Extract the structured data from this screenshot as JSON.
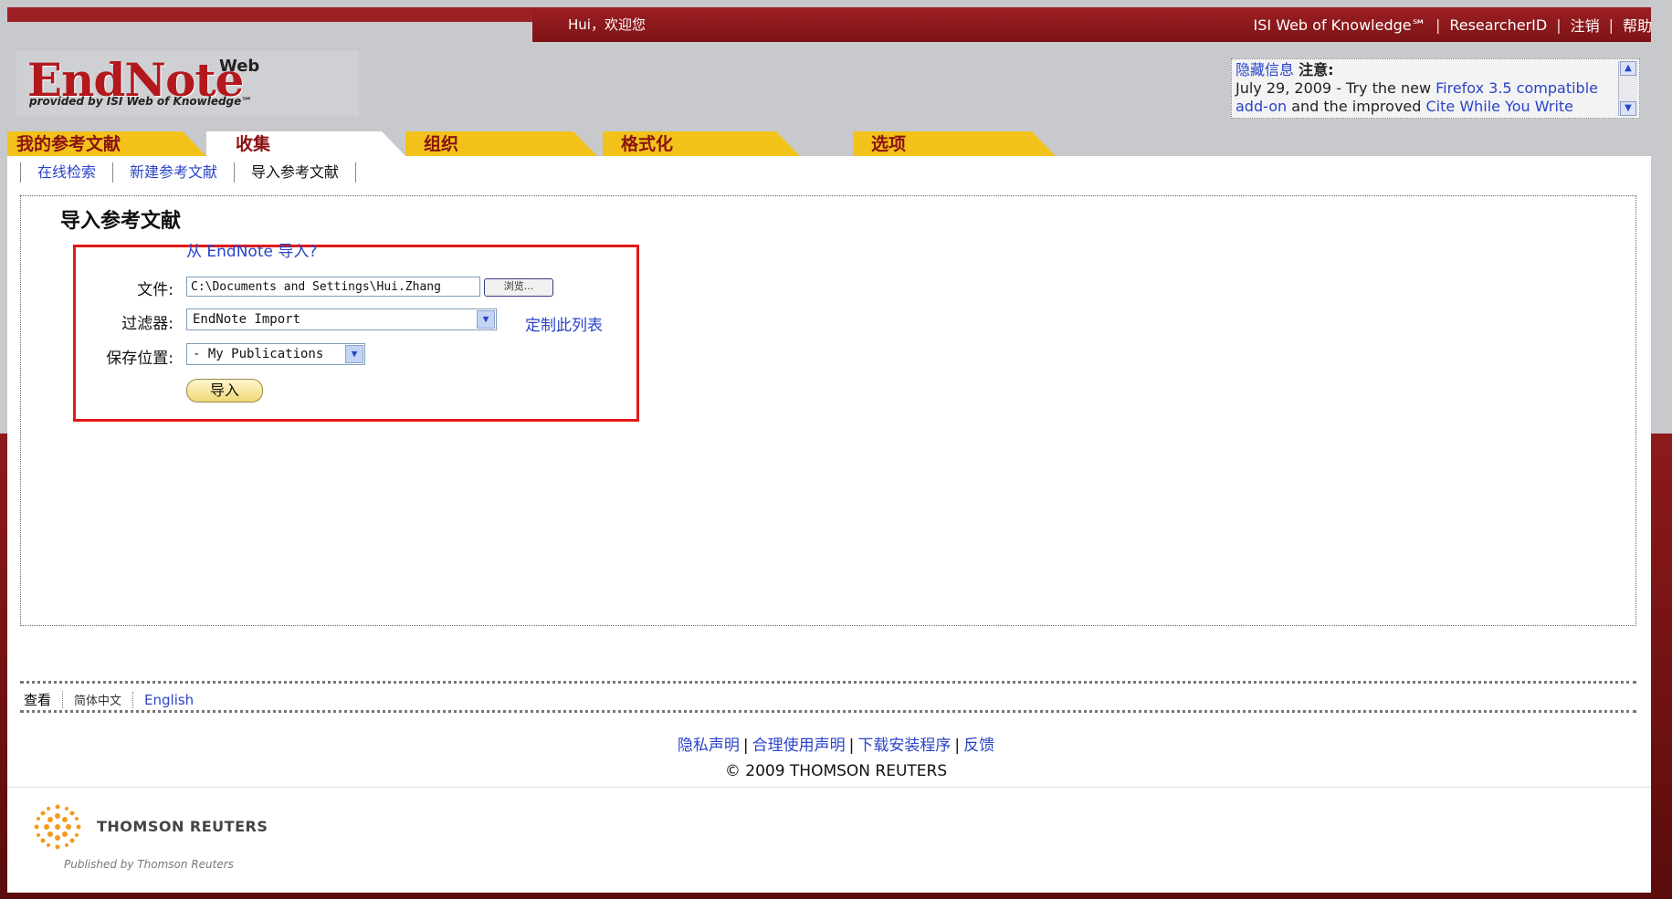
{
  "header": {
    "welcome": "Hui，欢迎您",
    "links": [
      "ISI Web of Knowledge℠",
      "ResearcherID",
      "注销",
      "帮助"
    ],
    "logo_main": "EndNote",
    "logo_web": "Web",
    "logo_sub": "provided by ISI Web of Knowledge℠"
  },
  "notice": {
    "hide": "隐藏信息",
    "title": "注意:",
    "line1_prefix": "July 29, 2009 - Try the new ",
    "line1_link": "Firefox 3.5 compatible",
    "line2_link": "add-on",
    "line2_mid": " and the improved ",
    "line2_link2": "Cite While You Write"
  },
  "tabs": [
    "我的参考文献",
    "收集",
    "组织",
    "格式化",
    "选项"
  ],
  "active_tab": "收集",
  "subnav": [
    "在线检索",
    "新建参考文献",
    "导入参考文献"
  ],
  "main": {
    "title": "导入参考文献",
    "from_endnote": "从 EndNote 导入?",
    "file_label": "文件:",
    "file_value": "C:\\Documents and Settings\\Hui.Zhang",
    "browse": "浏览...",
    "filter_label": "过滤器:",
    "filter_value": "EndNote Import",
    "customize": "定制此列表",
    "save_label": "保存位置:",
    "save_value": "- My Publications",
    "import_btn": "导入"
  },
  "footer": {
    "view": "查看",
    "lang1": "简体中文",
    "lang2": "English",
    "links": [
      "隐私声明",
      "合理使用声明",
      "下载安装程序",
      "反馈"
    ],
    "copyright": "© 2009 THOMSON REUTERS",
    "brand": "THOMSON REUTERS",
    "published": "Published by Thomson Reuters"
  }
}
